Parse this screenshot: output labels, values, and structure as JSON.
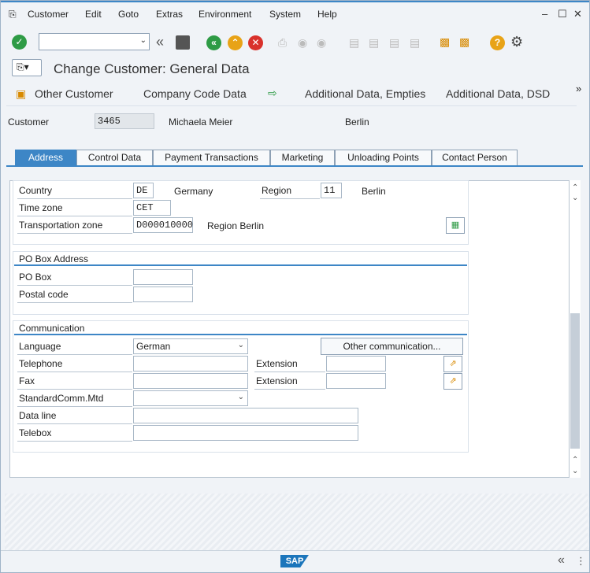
{
  "menubar": {
    "items": [
      "Customer",
      "Edit",
      "Goto",
      "Extras",
      "Environment",
      "System",
      "Help"
    ],
    "mnemonic": [
      "C",
      "E",
      "G",
      "x",
      "n",
      "S",
      "H"
    ]
  },
  "toolbar": {
    "command_field_value": ""
  },
  "title": "Change Customer: General Data",
  "app_toolbar": {
    "other_customer": "Other Customer",
    "company_code_data": "Company Code Data",
    "additional_empties": "Additional Data, Empties",
    "additional_dsd": "Additional Data, DSD",
    "more": "»"
  },
  "header": {
    "customer_label": "Customer",
    "customer_number": "3465",
    "customer_name": "Michaela Meier",
    "city": "Berlin"
  },
  "tabs": [
    {
      "label": "Address",
      "active": true
    },
    {
      "label": "Control Data",
      "active": false
    },
    {
      "label": "Payment Transactions",
      "active": false
    },
    {
      "label": "Marketing",
      "active": false
    },
    {
      "label": "Unloading Points",
      "active": false
    },
    {
      "label": "Contact Person",
      "active": false
    }
  ],
  "address": {
    "country_label": "Country",
    "country_value": "DE",
    "country_name": "Germany",
    "region_label": "Region",
    "region_value": "11",
    "region_name": "Berlin",
    "timezone_label": "Time zone",
    "timezone_value": "CET",
    "transport_label": "Transportation zone",
    "transport_value": "D000010000",
    "transport_name": "Region Berlin"
  },
  "po_box": {
    "title": "PO Box Address",
    "po_box_label": "PO Box",
    "po_box_value": "",
    "postal_label": "Postal code",
    "postal_value": ""
  },
  "communication": {
    "title": "Communication",
    "language_label": "Language",
    "language_value": "German",
    "other_comm_button": "Other communication...",
    "telephone_label": "Telephone",
    "telephone_value": "",
    "extension_label": "Extension",
    "tel_extension_value": "",
    "fax_label": "Fax",
    "fax_value": "",
    "fax_extension_value": "",
    "std_comm_label": "StandardComm.Mtd",
    "std_comm_value": "",
    "data_line_label": "Data line",
    "data_line_value": "",
    "telebox_label": "Telebox",
    "telebox_value": ""
  },
  "footer": {
    "logo": "SAP",
    "collapse": "«"
  },
  "colors": {
    "accent": "#3d86c6",
    "ok_green": "#2e9b45",
    "nav_green": "#2e9b45",
    "nav_yellow": "#e8a317",
    "cancel_red": "#d9312b"
  }
}
